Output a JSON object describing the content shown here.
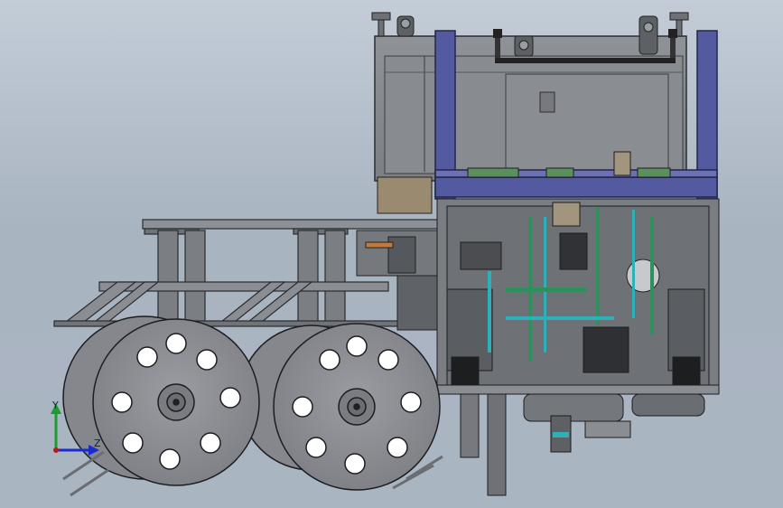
{
  "viewport": {
    "background_top": "#c3ccd7",
    "background_bottom": "#a9b4c1"
  },
  "model": {
    "frame_color": "#545aa0",
    "body_color": "#8c8f94",
    "dark_color": "#3a3c40",
    "wheel_color": "#8e9096",
    "accent_green": "#2f8f5e",
    "accent_cyan": "#2fb0b8",
    "accent_orange": "#c27a3a"
  },
  "triad": {
    "y_label": "Y",
    "z_label": "Z",
    "y_color": "#1e9a33",
    "z_color": "#1a2bd0",
    "x_color": "#c01818"
  }
}
